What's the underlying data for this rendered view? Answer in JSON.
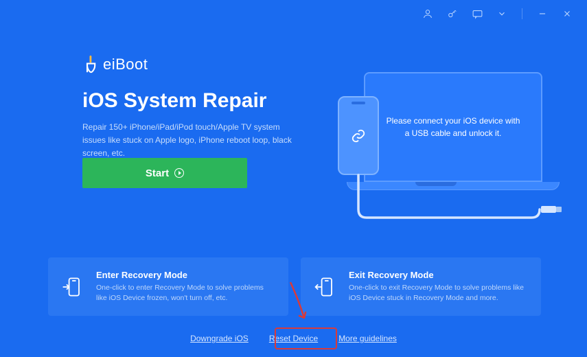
{
  "titlebar": {
    "icons": [
      "user",
      "key",
      "feedback",
      "dropdown",
      "minimize",
      "close"
    ]
  },
  "logo": {
    "text": "eiBoot"
  },
  "hero": {
    "title": "iOS System Repair",
    "subtitle": "Repair 150+ iPhone/iPad/iPod touch/Apple TV system issues like stuck on Apple logo, iPhone reboot loop, black screen, etc.",
    "start_label": "Start"
  },
  "device_prompt": "Please connect your iOS device with a USB cable and unlock it.",
  "cards": {
    "enter": {
      "title": "Enter Recovery Mode",
      "desc": "One-click to enter Recovery Mode to solve problems like iOS Device frozen, won't turn off, etc."
    },
    "exit": {
      "title": "Exit Recovery Mode",
      "desc": "One-click to exit Recovery Mode to solve problems like iOS Device stuck in Recovery Mode and more."
    }
  },
  "footer": {
    "downgrade": "Downgrade iOS",
    "reset": "Reset Device",
    "guidelines": "More guidelines"
  }
}
